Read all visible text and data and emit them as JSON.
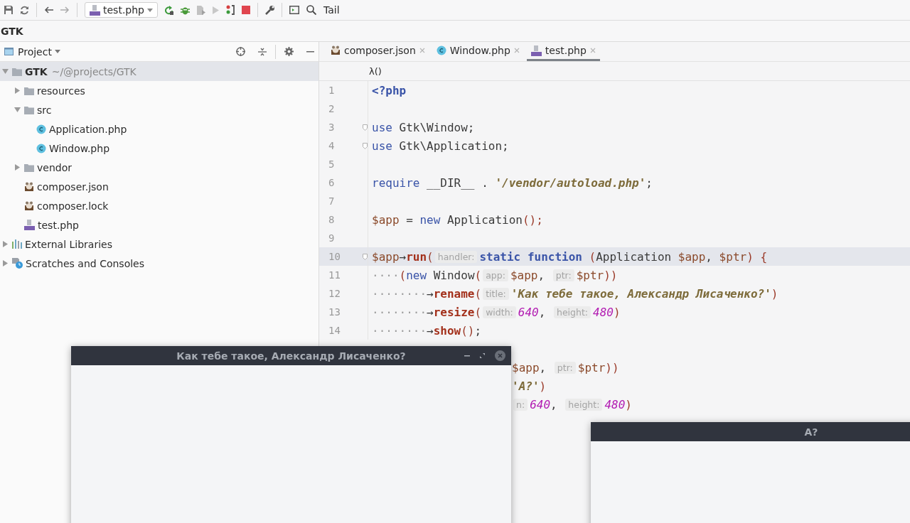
{
  "toolbar": {
    "run_config": "test.php",
    "search_label": "Tail"
  },
  "navbar": {
    "project": "GTK"
  },
  "project_panel": {
    "title": "Project",
    "tree": [
      {
        "label": "GTK",
        "path": "~/@projects/GTK",
        "kind": "folder",
        "expanded": true,
        "selected": true,
        "children": [
          {
            "label": "resources",
            "kind": "folder",
            "expanded": false,
            "selected": false
          },
          {
            "label": "src",
            "kind": "folder",
            "expanded": true,
            "selected": false,
            "children": [
              {
                "label": "Application.php",
                "kind": "class",
                "selected": false
              },
              {
                "label": "Window.php",
                "kind": "class",
                "selected": false
              }
            ]
          },
          {
            "label": "vendor",
            "kind": "folder",
            "expanded": false,
            "selected": false
          },
          {
            "label": "composer.json",
            "kind": "composer",
            "selected": false
          },
          {
            "label": "composer.lock",
            "kind": "composer",
            "selected": false
          },
          {
            "label": "test.php",
            "kind": "php",
            "selected": false
          }
        ]
      },
      {
        "label": "External Libraries",
        "kind": "libraries",
        "expanded": false,
        "selected": false
      },
      {
        "label": "Scratches and Consoles",
        "kind": "scratches",
        "expanded": false,
        "selected": false
      }
    ]
  },
  "editor": {
    "tabs": [
      {
        "label": "composer.json",
        "kind": "composer",
        "selected": false
      },
      {
        "label": "Window.php",
        "kind": "class",
        "selected": false
      },
      {
        "label": "test.php",
        "kind": "php",
        "selected": true
      }
    ],
    "breadcrumb": "λ()",
    "lines": [
      {
        "kind": "full",
        "number": "1",
        "current": false,
        "fold": false,
        "tokens": [
          {
            "kind": "kwb",
            "text": "<?php"
          }
        ]
      },
      {
        "kind": "full",
        "number": "2",
        "current": false,
        "fold": false
      },
      {
        "kind": "full",
        "number": "3",
        "current": false,
        "fold": true,
        "tokens": [
          {
            "kind": "kw",
            "text": "use"
          },
          {
            "kind": "p",
            "text": " Gtk\\Window;"
          }
        ]
      },
      {
        "kind": "full",
        "number": "4",
        "current": false,
        "fold": true,
        "tokens": [
          {
            "kind": "kw",
            "text": "use"
          },
          {
            "kind": "p",
            "text": " Gtk\\Application;"
          }
        ]
      },
      {
        "kind": "full",
        "number": "5",
        "current": false,
        "fold": false
      },
      {
        "kind": "full",
        "number": "6",
        "current": false,
        "fold": false,
        "tokens": [
          {
            "kind": "kw",
            "text": "require"
          },
          {
            "kind": "p",
            "text": " __DIR__ . "
          },
          {
            "kind": "str",
            "text": "'/vendor/autoload.php'"
          },
          {
            "kind": "p",
            "text": ";"
          }
        ]
      },
      {
        "kind": "full",
        "number": "7",
        "current": false,
        "fold": false
      },
      {
        "kind": "full",
        "number": "8",
        "current": false,
        "fold": false,
        "tokens": [
          {
            "kind": "var",
            "text": "$app"
          },
          {
            "kind": "p",
            "text": " = "
          },
          {
            "kind": "kw",
            "text": "new"
          },
          {
            "kind": "p",
            "text": " Application"
          },
          {
            "kind": "par",
            "text": "();"
          }
        ]
      },
      {
        "kind": "full",
        "number": "9",
        "current": false,
        "fold": false
      },
      {
        "kind": "full",
        "number": "10",
        "current": true,
        "fold": true,
        "tokens": [
          {
            "kind": "var",
            "text": "$app"
          },
          {
            "kind": "p",
            "text": "→"
          },
          {
            "kind": "fn",
            "text": "run"
          },
          {
            "kind": "par",
            "text": "("
          },
          {
            "kind": "hint",
            "text": "handler:"
          },
          {
            "kind": "kwb",
            "text": "static function"
          },
          {
            "kind": "par",
            "text": " ("
          },
          {
            "kind": "p",
            "text": "Application "
          },
          {
            "kind": "var",
            "text": "$app"
          },
          {
            "kind": "p",
            "text": ", "
          },
          {
            "kind": "var",
            "text": "$ptr"
          },
          {
            "kind": "par",
            "text": ") {"
          }
        ]
      },
      {
        "kind": "full",
        "number": "11",
        "current": false,
        "fold": false,
        "tokens": [
          {
            "kind": "ws",
            "text": "····"
          },
          {
            "kind": "par",
            "text": "("
          },
          {
            "kind": "kw",
            "text": "new"
          },
          {
            "kind": "p",
            "text": " Window"
          },
          {
            "kind": "par",
            "text": "("
          },
          {
            "kind": "hint",
            "text": "app:"
          },
          {
            "kind": "var",
            "text": "$app"
          },
          {
            "kind": "p",
            "text": ", "
          },
          {
            "kind": "hint",
            "text": "ptr:"
          },
          {
            "kind": "var",
            "text": "$ptr"
          },
          {
            "kind": "par",
            "text": "))"
          }
        ]
      },
      {
        "kind": "full",
        "number": "12",
        "current": false,
        "fold": false,
        "tokens": [
          {
            "kind": "ws",
            "text": "········"
          },
          {
            "kind": "p",
            "text": "→"
          },
          {
            "kind": "fn",
            "text": "rename"
          },
          {
            "kind": "par",
            "text": "("
          },
          {
            "kind": "hint",
            "text": "title:"
          },
          {
            "kind": "str",
            "text": "'Как тебе такое, Александр Лисаченко?'"
          },
          {
            "kind": "par",
            "text": ")"
          }
        ]
      },
      {
        "kind": "full",
        "number": "13",
        "current": false,
        "fold": false,
        "tokens": [
          {
            "kind": "ws",
            "text": "········"
          },
          {
            "kind": "p",
            "text": "→"
          },
          {
            "kind": "fn",
            "text": "resize"
          },
          {
            "kind": "par",
            "text": "("
          },
          {
            "kind": "hint",
            "text": "width:"
          },
          {
            "kind": "num",
            "text": "640"
          },
          {
            "kind": "p",
            "text": ", "
          },
          {
            "kind": "hint",
            "text": "height:"
          },
          {
            "kind": "num",
            "text": "480"
          },
          {
            "kind": "par",
            "text": ")"
          }
        ]
      },
      {
        "kind": "full",
        "number": "14",
        "current": false,
        "fold": false,
        "tokens": [
          {
            "kind": "ws",
            "text": "········"
          },
          {
            "kind": "p",
            "text": "→"
          },
          {
            "kind": "fn",
            "text": "show"
          },
          {
            "kind": "par",
            "text": "()"
          },
          {
            "kind": "p",
            "text": ";"
          }
        ]
      },
      {
        "kind": "partial",
        "current": false,
        "fold": false,
        "tokens": [
          {
            "kind": "var",
            "text": "$app"
          },
          {
            "kind": "p",
            "text": ", "
          },
          {
            "kind": "hint",
            "text": "ptr:"
          },
          {
            "kind": "var",
            "text": "$ptr"
          },
          {
            "kind": "par",
            "text": "))"
          }
        ]
      },
      {
        "kind": "partial",
        "current": false,
        "fold": false,
        "tokens": [
          {
            "kind": "str",
            "text": "'A?'"
          },
          {
            "kind": "par",
            "text": ")"
          }
        ]
      },
      {
        "kind": "partial",
        "current": false,
        "fold": false,
        "tokens": [
          {
            "kind": "hint",
            "text": "n:"
          },
          {
            "kind": "num",
            "text": "640"
          },
          {
            "kind": "p",
            "text": ", "
          },
          {
            "kind": "hint",
            "text": "height:"
          },
          {
            "kind": "num",
            "text": "480"
          },
          {
            "kind": "par",
            "text": ")"
          }
        ]
      }
    ]
  },
  "windows": [
    {
      "title": "Как тебе такое, Александр Лисаченко?",
      "kind": "front"
    },
    {
      "title": "A?",
      "kind": "back"
    }
  ]
}
